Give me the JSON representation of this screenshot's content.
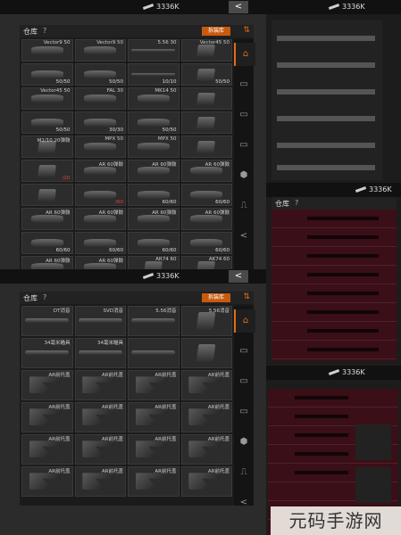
{
  "top": {
    "money": "3336K",
    "back": "<"
  },
  "panel1": {
    "title": "仓库",
    "help": "?",
    "button": "拆装库",
    "sort_icon": "sort-icon",
    "tabs": [
      "⌂",
      "▭",
      "▭",
      "▭",
      "⬢",
      "⎍",
      "<"
    ],
    "items": [
      {
        "name": "Vector9 50",
        "count": "",
        "kind": "shape"
      },
      {
        "name": "Vector9 50",
        "count": "",
        "kind": "shape"
      },
      {
        "name": "5.56 30",
        "count": "",
        "kind": "long"
      },
      {
        "name": "Vector45 50",
        "count": "",
        "kind": "mag"
      },
      {
        "name": "",
        "count": "50/50",
        "kind": "shape"
      },
      {
        "name": "",
        "count": "50/50",
        "kind": "shape"
      },
      {
        "name": "",
        "count": "10/10",
        "kind": "long"
      },
      {
        "name": "",
        "count": "50/50",
        "kind": "mag"
      },
      {
        "name": "Vector45 50",
        "count": "",
        "kind": "shape"
      },
      {
        "name": "FAL 30",
        "count": "",
        "kind": "shape"
      },
      {
        "name": "MK14 50",
        "count": "",
        "kind": "shape"
      },
      {
        "name": "",
        "count": "",
        "kind": "mag"
      },
      {
        "name": "",
        "count": "50/50",
        "kind": "shape"
      },
      {
        "name": "",
        "count": "30/30",
        "kind": "shape"
      },
      {
        "name": "",
        "count": "50/50",
        "kind": "shape"
      },
      {
        "name": "",
        "count": "",
        "kind": "mag"
      },
      {
        "name": "M1/10 20弹鼓",
        "count": "",
        "kind": "mag"
      },
      {
        "name": "MPX 50",
        "count": "",
        "kind": "shape"
      },
      {
        "name": "MPX 50",
        "count": "",
        "kind": "shape"
      },
      {
        "name": "",
        "count": "",
        "kind": "mag"
      },
      {
        "name": "",
        "count": "/20",
        "kind": "mag",
        "red": true
      },
      {
        "name": "AR 60弹鼓",
        "count": "",
        "kind": "shape"
      },
      {
        "name": "AR 60弹鼓",
        "count": "",
        "kind": "shape"
      },
      {
        "name": "AR 60弹鼓",
        "count": "",
        "kind": "shape"
      },
      {
        "name": "",
        "count": "",
        "kind": "mag"
      },
      {
        "name": "",
        "count": "/60",
        "kind": "shape",
        "red": true
      },
      {
        "name": "",
        "count": "60/60",
        "kind": "shape"
      },
      {
        "name": "",
        "count": "60/60",
        "kind": "shape"
      },
      {
        "name": "AR 60弹鼓",
        "count": "",
        "kind": "shape"
      },
      {
        "name": "AR 60弹鼓",
        "count": "",
        "kind": "shape"
      },
      {
        "name": "AR 60弹鼓",
        "count": "",
        "kind": "shape"
      },
      {
        "name": "AR 60弹鼓",
        "count": "",
        "kind": "shape"
      },
      {
        "name": "",
        "count": "60/60",
        "kind": "shape"
      },
      {
        "name": "",
        "count": "60/60",
        "kind": "shape"
      },
      {
        "name": "",
        "count": "60/60",
        "kind": "shape"
      },
      {
        "name": "",
        "count": "60/60",
        "kind": "shape"
      },
      {
        "name": "AR 60弹鼓",
        "count": "",
        "kind": "shape"
      },
      {
        "name": "AR 60弹鼓",
        "count": "",
        "kind": "shape"
      },
      {
        "name": "AR74 60",
        "count": "",
        "kind": "mag"
      },
      {
        "name": "AK74 60",
        "count": "",
        "kind": "mag"
      }
    ]
  },
  "panel2": {
    "money": "3336K",
    "back": "<",
    "title": "仓库",
    "help": "?",
    "button": "拆装库",
    "tabs": [
      "⌂",
      "▭",
      "▭",
      "▭",
      "⬢",
      "⎍",
      "<"
    ],
    "items": [
      {
        "name": "DT消音",
        "kind": "long"
      },
      {
        "name": "SVD消音",
        "kind": "long"
      },
      {
        "name": "5.56消音",
        "kind": "long"
      },
      {
        "name": "5.56消音",
        "kind": "mag"
      },
      {
        "name": "34毫米瞄具",
        "kind": "long"
      },
      {
        "name": "34毫米瞄具",
        "kind": "long"
      },
      {
        "name": "",
        "kind": "long"
      },
      {
        "name": "",
        "kind": "mag"
      },
      {
        "name": "AR前托盖",
        "kind": "stock"
      },
      {
        "name": "AR前托盖",
        "kind": "stock"
      },
      {
        "name": "AR前托盖",
        "kind": "stock"
      },
      {
        "name": "AR前托盖",
        "kind": "stock"
      },
      {
        "name": "AR前托盖",
        "kind": "stock"
      },
      {
        "name": "AR前托盖",
        "kind": "stock"
      },
      {
        "name": "AR前托盖",
        "kind": "stock"
      },
      {
        "name": "AR前托盖",
        "kind": "stock"
      },
      {
        "name": "AR前托盖",
        "kind": "stock"
      },
      {
        "name": "AR前托盖",
        "kind": "stock"
      },
      {
        "name": "AR前托盖",
        "kind": "stock"
      },
      {
        "name": "AR前托盖",
        "kind": "stock"
      },
      {
        "name": "AR前托盖",
        "kind": "stock"
      },
      {
        "name": "AR前托盖",
        "kind": "stock"
      },
      {
        "name": "AR前托盖",
        "kind": "stock"
      },
      {
        "name": "AR前托盖",
        "kind": "stock"
      }
    ]
  },
  "right": {
    "money1": "3336K",
    "money2": "3336K",
    "money3": "3336K",
    "title": "仓库",
    "help": "?"
  },
  "watermark": "元码手游网",
  "colors": {
    "accent": "#e46a1a",
    "red_bg": "#3a0f17"
  }
}
